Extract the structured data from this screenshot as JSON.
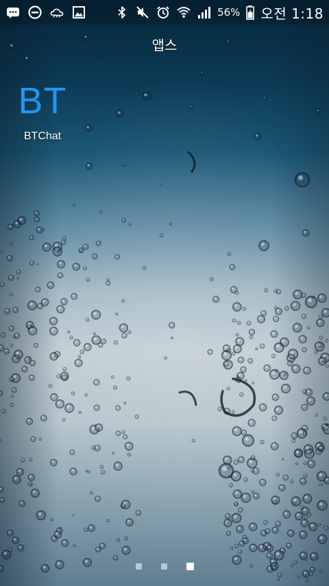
{
  "status_bar": {
    "battery_percent": "56%",
    "clock": "오전 1:18",
    "left_icons": [
      "message-icon",
      "do-not-disturb-icon",
      "weather-icon",
      "gallery-icon"
    ],
    "right_icons": [
      "bluetooth-icon",
      "mute-icon",
      "alarm-icon",
      "wifi-icon",
      "signal-icon",
      "battery-charging-icon"
    ]
  },
  "header": {
    "title": "앱스"
  },
  "apps": [
    {
      "icon_text": "BT",
      "label": "BTChat",
      "icon_color": "#2196f3"
    }
  ],
  "page_indicator": {
    "total": 3,
    "active_index": 2
  },
  "colors": {
    "accent": "#2196f3",
    "text": "#ffffff"
  }
}
